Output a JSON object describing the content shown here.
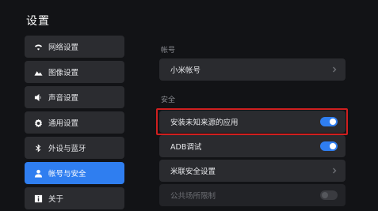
{
  "header": {
    "title": "设置"
  },
  "sidebar": {
    "items": [
      {
        "label": "网络设置",
        "icon": "wifi-icon"
      },
      {
        "label": "图像设置",
        "icon": "image-icon"
      },
      {
        "label": "声音设置",
        "icon": "speaker-icon"
      },
      {
        "label": "通用设置",
        "icon": "gear-icon"
      },
      {
        "label": "外设与蓝牙",
        "icon": "bluetooth-icon"
      },
      {
        "label": "帐号与安全",
        "icon": "user-icon",
        "active": true
      },
      {
        "label": "关于",
        "icon": "info-icon"
      }
    ]
  },
  "main": {
    "account_section": {
      "label": "帐号",
      "xiaomi_account": "小米帐号"
    },
    "security_section": {
      "label": "安全",
      "unknown_sources": {
        "label": "安装未知来源的应用",
        "enabled": true
      },
      "adb_debug": {
        "label": "ADB调试",
        "enabled": true
      },
      "mi_link_security": {
        "label": "米联安全设置"
      },
      "public_place_limit": {
        "label": "公共场所限制",
        "enabled": false
      }
    }
  },
  "colors": {
    "accent": "#2f7ef0",
    "highlight_border": "#d01f1f",
    "background": "#121316"
  }
}
